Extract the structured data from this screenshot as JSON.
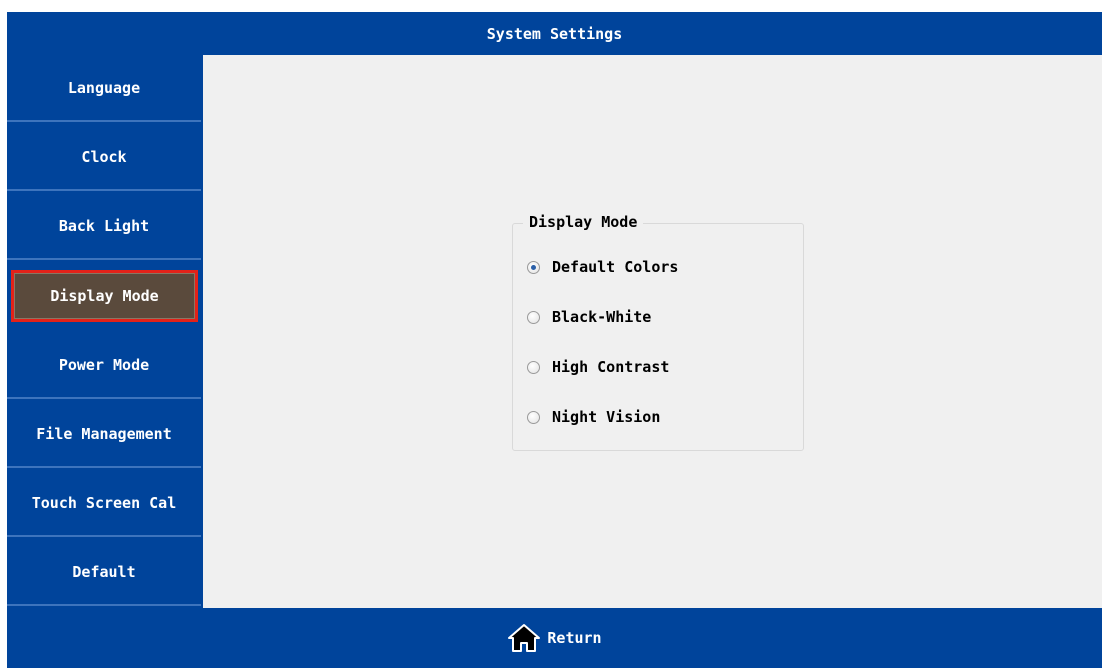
{
  "title_bar": {
    "title": "System Settings"
  },
  "sidebar": {
    "items": [
      {
        "label": "Language",
        "active": false
      },
      {
        "label": "Clock",
        "active": false
      },
      {
        "label": "Back Light",
        "active": false
      },
      {
        "label": "Display Mode",
        "active": true
      },
      {
        "label": "Power Mode",
        "active": false
      },
      {
        "label": "File Management",
        "active": false
      },
      {
        "label": "Touch Screen Cal",
        "active": false
      },
      {
        "label": "Default",
        "active": false
      }
    ]
  },
  "display_mode": {
    "group_title": "Display Mode",
    "options": [
      {
        "label": "Default Colors",
        "checked": true
      },
      {
        "label": "Black-White",
        "checked": false
      },
      {
        "label": "High Contrast",
        "checked": false
      },
      {
        "label": "Night Vision",
        "checked": false
      }
    ]
  },
  "bottom_bar": {
    "return_label": "Return",
    "icon": "home-icon"
  },
  "colors": {
    "bar_blue": "#00449b",
    "active_item": "#5a4a3c",
    "active_outline": "#e32219",
    "content_bg": "#f0f0f0"
  }
}
